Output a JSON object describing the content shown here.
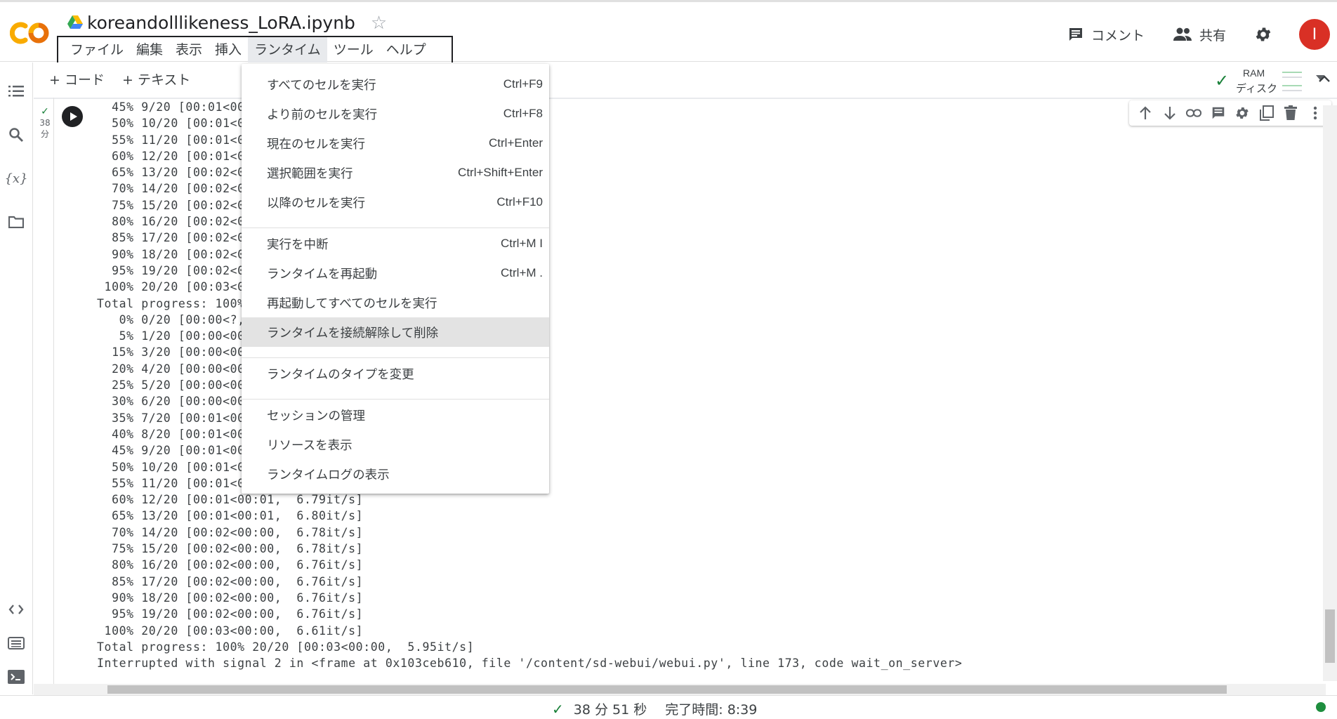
{
  "header": {
    "title": "koreandolllikeness_LoRA.ipynb",
    "menu": [
      "ファイル",
      "編集",
      "表示",
      "挿入",
      "ランタイム",
      "ツール",
      "ヘルプ"
    ],
    "comment_label": "コメント",
    "share_label": "共有",
    "avatar_letter": "I"
  },
  "toolbar": {
    "add_code": "+ コード",
    "add_text": "+ テキスト",
    "ram_label": "RAM",
    "disk_label": "ディスク"
  },
  "cell": {
    "exec_time_top": "38",
    "exec_time_bottom": "分",
    "output_lines": [
      "  45% 9/20 [00:01<00:0",
      "  50% 10/20 [00:01<00:",
      "  55% 11/20 [00:01<00:",
      "  60% 12/20 [00:01<00:",
      "  65% 13/20 [00:02<00:",
      "  70% 14/20 [00:02<00:",
      "  75% 15/20 [00:02<00:",
      "  80% 16/20 [00:02<00:",
      "  85% 17/20 [00:02<00:",
      "  90% 18/20 [00:02<00:",
      "  95% 19/20 [00:02<00:",
      " 100% 20/20 [00:03<00:",
      "Total progress: 100%",
      "   0% 0/20 [00:00<?, ?",
      "   5% 1/20 [00:00<00:0",
      "  15% 3/20 [00:00<00:0",
      "  20% 4/20 [00:00<00:0",
      "  25% 5/20 [00:00<00:0",
      "  30% 6/20 [00:00<00:0",
      "  35% 7/20 [00:01<00:0",
      "  40% 8/20 [00:01<00:0",
      "  45% 9/20 [00:01<00:0",
      "  50% 10/20 [00:01<00:",
      "  55% 11/20 [00:01<00:",
      "  60% 12/20 [00:01<00:01,  6.79it/s]",
      "  65% 13/20 [00:01<00:01,  6.80it/s]",
      "  70% 14/20 [00:02<00:00,  6.78it/s]",
      "  75% 15/20 [00:02<00:00,  6.78it/s]",
      "  80% 16/20 [00:02<00:00,  6.76it/s]",
      "  85% 17/20 [00:02<00:00,  6.76it/s]",
      "  90% 18/20 [00:02<00:00,  6.76it/s]",
      "  95% 19/20 [00:02<00:00,  6.76it/s]",
      " 100% 20/20 [00:03<00:00,  6.61it/s]",
      "Total progress: 100% 20/20 [00:03<00:00,  5.95it/s]",
      "Interrupted with signal 2 in <frame at 0x103ceb610, file '/content/sd-webui/webui.py', line 173, code wait_on_server>"
    ]
  },
  "runtime_menu": {
    "items": [
      {
        "label": "すべてのセルを実行",
        "shortcut": "Ctrl+F9"
      },
      {
        "label": "より前のセルを実行",
        "shortcut": "Ctrl+F8"
      },
      {
        "label": "現在のセルを実行",
        "shortcut": "Ctrl+Enter"
      },
      {
        "label": "選択範囲を実行",
        "shortcut": "Ctrl+Shift+Enter"
      },
      {
        "label": "以降のセルを実行",
        "shortcut": "Ctrl+F10"
      },
      {
        "label": "実行を中断",
        "shortcut": "Ctrl+M I"
      },
      {
        "label": "ランタイムを再起動",
        "shortcut": "Ctrl+M ."
      },
      {
        "label": "再起動してすべてのセルを実行",
        "shortcut": ""
      },
      {
        "label": "ランタイムを接続解除して削除",
        "shortcut": ""
      },
      {
        "label": "ランタイムのタイプを変更",
        "shortcut": ""
      },
      {
        "label": "セッションの管理",
        "shortcut": ""
      },
      {
        "label": "リソースを表示",
        "shortcut": ""
      },
      {
        "label": "ランタイムログの表示",
        "shortcut": ""
      }
    ],
    "highlighted_index": 8
  },
  "status": {
    "elapsed": "38 分 51 秒",
    "completed": "完了時間: 8:39"
  },
  "colors": {
    "accent_orange": "#f9ab00",
    "ok_green": "#188038",
    "avatar_red": "#d93025"
  }
}
